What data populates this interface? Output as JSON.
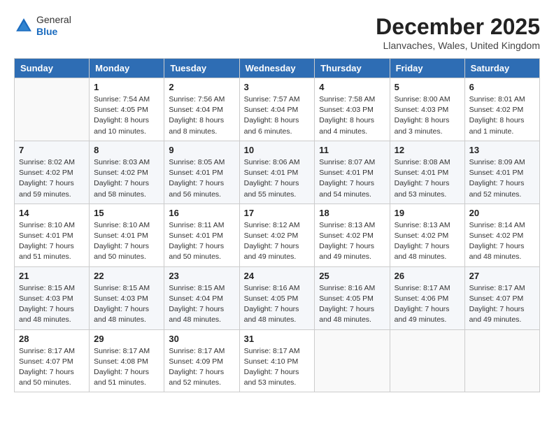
{
  "header": {
    "logo_line1": "General",
    "logo_line2": "Blue",
    "month_year": "December 2025",
    "location": "Llanvaches, Wales, United Kingdom"
  },
  "days_of_week": [
    "Sunday",
    "Monday",
    "Tuesday",
    "Wednesday",
    "Thursday",
    "Friday",
    "Saturday"
  ],
  "weeks": [
    [
      {
        "day": "",
        "info": ""
      },
      {
        "day": "1",
        "info": "Sunrise: 7:54 AM\nSunset: 4:05 PM\nDaylight: 8 hours\nand 10 minutes."
      },
      {
        "day": "2",
        "info": "Sunrise: 7:56 AM\nSunset: 4:04 PM\nDaylight: 8 hours\nand 8 minutes."
      },
      {
        "day": "3",
        "info": "Sunrise: 7:57 AM\nSunset: 4:04 PM\nDaylight: 8 hours\nand 6 minutes."
      },
      {
        "day": "4",
        "info": "Sunrise: 7:58 AM\nSunset: 4:03 PM\nDaylight: 8 hours\nand 4 minutes."
      },
      {
        "day": "5",
        "info": "Sunrise: 8:00 AM\nSunset: 4:03 PM\nDaylight: 8 hours\nand 3 minutes."
      },
      {
        "day": "6",
        "info": "Sunrise: 8:01 AM\nSunset: 4:02 PM\nDaylight: 8 hours\nand 1 minute."
      }
    ],
    [
      {
        "day": "7",
        "info": "Sunrise: 8:02 AM\nSunset: 4:02 PM\nDaylight: 7 hours\nand 59 minutes."
      },
      {
        "day": "8",
        "info": "Sunrise: 8:03 AM\nSunset: 4:02 PM\nDaylight: 7 hours\nand 58 minutes."
      },
      {
        "day": "9",
        "info": "Sunrise: 8:05 AM\nSunset: 4:01 PM\nDaylight: 7 hours\nand 56 minutes."
      },
      {
        "day": "10",
        "info": "Sunrise: 8:06 AM\nSunset: 4:01 PM\nDaylight: 7 hours\nand 55 minutes."
      },
      {
        "day": "11",
        "info": "Sunrise: 8:07 AM\nSunset: 4:01 PM\nDaylight: 7 hours\nand 54 minutes."
      },
      {
        "day": "12",
        "info": "Sunrise: 8:08 AM\nSunset: 4:01 PM\nDaylight: 7 hours\nand 53 minutes."
      },
      {
        "day": "13",
        "info": "Sunrise: 8:09 AM\nSunset: 4:01 PM\nDaylight: 7 hours\nand 52 minutes."
      }
    ],
    [
      {
        "day": "14",
        "info": "Sunrise: 8:10 AM\nSunset: 4:01 PM\nDaylight: 7 hours\nand 51 minutes."
      },
      {
        "day": "15",
        "info": "Sunrise: 8:10 AM\nSunset: 4:01 PM\nDaylight: 7 hours\nand 50 minutes."
      },
      {
        "day": "16",
        "info": "Sunrise: 8:11 AM\nSunset: 4:01 PM\nDaylight: 7 hours\nand 50 minutes."
      },
      {
        "day": "17",
        "info": "Sunrise: 8:12 AM\nSunset: 4:02 PM\nDaylight: 7 hours\nand 49 minutes."
      },
      {
        "day": "18",
        "info": "Sunrise: 8:13 AM\nSunset: 4:02 PM\nDaylight: 7 hours\nand 49 minutes."
      },
      {
        "day": "19",
        "info": "Sunrise: 8:13 AM\nSunset: 4:02 PM\nDaylight: 7 hours\nand 48 minutes."
      },
      {
        "day": "20",
        "info": "Sunrise: 8:14 AM\nSunset: 4:02 PM\nDaylight: 7 hours\nand 48 minutes."
      }
    ],
    [
      {
        "day": "21",
        "info": "Sunrise: 8:15 AM\nSunset: 4:03 PM\nDaylight: 7 hours\nand 48 minutes."
      },
      {
        "day": "22",
        "info": "Sunrise: 8:15 AM\nSunset: 4:03 PM\nDaylight: 7 hours\nand 48 minutes."
      },
      {
        "day": "23",
        "info": "Sunrise: 8:15 AM\nSunset: 4:04 PM\nDaylight: 7 hours\nand 48 minutes."
      },
      {
        "day": "24",
        "info": "Sunrise: 8:16 AM\nSunset: 4:05 PM\nDaylight: 7 hours\nand 48 minutes."
      },
      {
        "day": "25",
        "info": "Sunrise: 8:16 AM\nSunset: 4:05 PM\nDaylight: 7 hours\nand 48 minutes."
      },
      {
        "day": "26",
        "info": "Sunrise: 8:17 AM\nSunset: 4:06 PM\nDaylight: 7 hours\nand 49 minutes."
      },
      {
        "day": "27",
        "info": "Sunrise: 8:17 AM\nSunset: 4:07 PM\nDaylight: 7 hours\nand 49 minutes."
      }
    ],
    [
      {
        "day": "28",
        "info": "Sunrise: 8:17 AM\nSunset: 4:07 PM\nDaylight: 7 hours\nand 50 minutes."
      },
      {
        "day": "29",
        "info": "Sunrise: 8:17 AM\nSunset: 4:08 PM\nDaylight: 7 hours\nand 51 minutes."
      },
      {
        "day": "30",
        "info": "Sunrise: 8:17 AM\nSunset: 4:09 PM\nDaylight: 7 hours\nand 52 minutes."
      },
      {
        "day": "31",
        "info": "Sunrise: 8:17 AM\nSunset: 4:10 PM\nDaylight: 7 hours\nand 53 minutes."
      },
      {
        "day": "",
        "info": ""
      },
      {
        "day": "",
        "info": ""
      },
      {
        "day": "",
        "info": ""
      }
    ]
  ]
}
